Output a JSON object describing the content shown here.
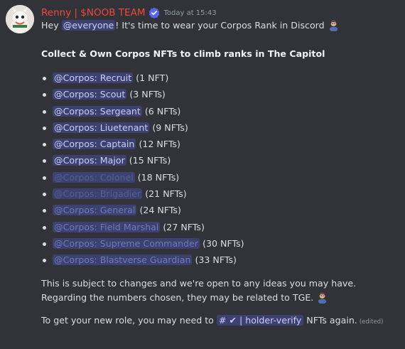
{
  "message": {
    "author": "Renny | $NOOB TEAM",
    "timestamp": "Today at 15:43",
    "greeting_prefix": "Hey ",
    "everyone_mention": "@everyone",
    "greeting_suffix": "! It's time to wear your Corpos Rank in Discord",
    "heading": "Collect & Own Corpos NFTs to climb ranks in The Capitol",
    "ranks": [
      {
        "role": "@Corpos: Recruit",
        "count": "(1 NFT)"
      },
      {
        "role": "@Corpos: Scout",
        "count": "(3 NFTs)"
      },
      {
        "role": "@Corpos: Sergeant",
        "count": "(6 NFTs)"
      },
      {
        "role": "@Corpos: Liuetenant",
        "count": "(9 NFTs)"
      },
      {
        "role": "@Corpos: Captain",
        "count": "(12 NFTs)"
      },
      {
        "role": "@Corpos: Major",
        "count": "(15 NFTs)"
      },
      {
        "role": "@Corpos: Colonel",
        "count": "(18 NFTs)"
      },
      {
        "role": "@Corpos: Brigadier",
        "count": "(21 NFTs)"
      },
      {
        "role": "@Corpos: General",
        "count": "(24 NFTs)"
      },
      {
        "role": "@Corpos: Field Marshal",
        "count": "(27 NFTs)"
      },
      {
        "role": "@Corpos: Supreme Commander",
        "count": "(30 NFTs)"
      },
      {
        "role": "@Corpos: Blastverse Guardian",
        "count": "(33 NFTs)"
      }
    ],
    "note_line1": "This is subject to changes and we're open to any ideas you may have.",
    "note_line2": "Regarding the numbers chosen, they may be related to TGE.",
    "footer_prefix": "To get your new role, you may need to ",
    "channel": "# ✔ | holder-verify",
    "footer_suffix": " NFTs again.",
    "edited": "(edited)"
  },
  "colors": {
    "background": "#313338",
    "author": "#f0473e",
    "mention_bg": "#3c4270",
    "verified": "#5865f2"
  },
  "icons": [
    "user-avatar-icon",
    "verified-badge-icon",
    "person-emoji-icon"
  ]
}
